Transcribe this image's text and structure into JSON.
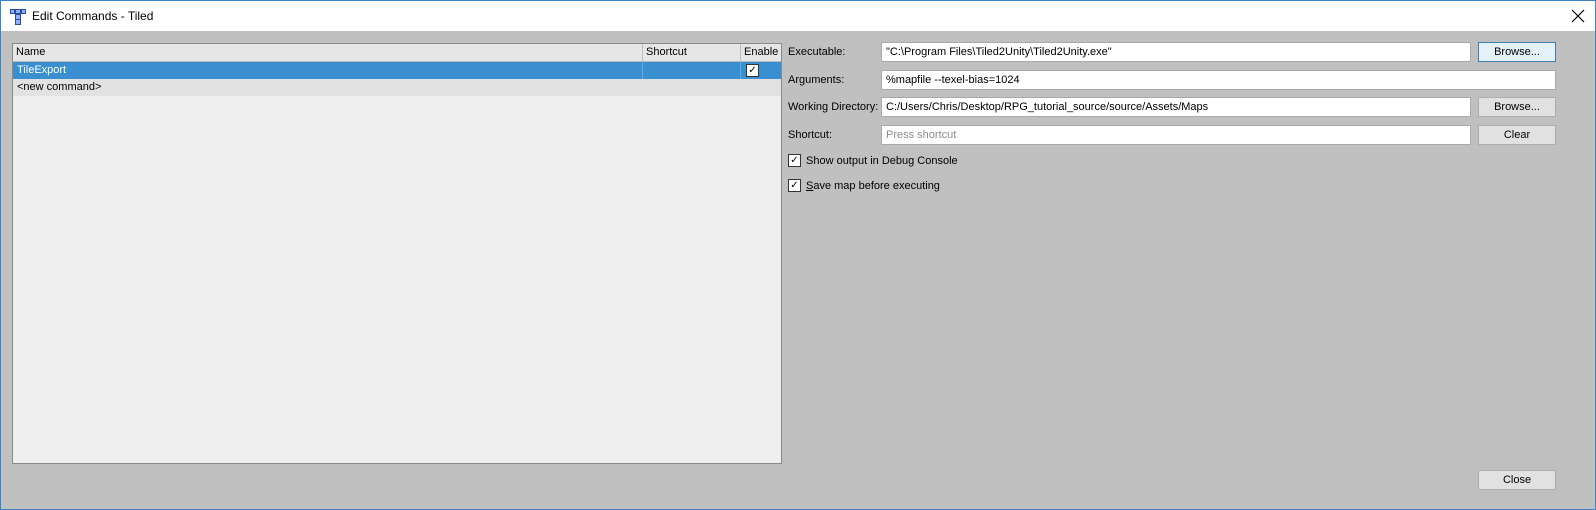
{
  "window": {
    "title": "Edit Commands - Tiled"
  },
  "table": {
    "columns": [
      "Name",
      "Shortcut",
      "Enable"
    ],
    "rows": [
      {
        "name": "TileExport",
        "shortcut": "",
        "enabled": true,
        "selected": true
      },
      {
        "name": "<new command>",
        "shortcut": "",
        "enabled": false,
        "selected": false
      }
    ]
  },
  "form": {
    "executable_label": "Executable:",
    "executable_value": "\"C:\\Program Files\\Tiled2Unity\\Tiled2Unity.exe\"",
    "browse_label": "Browse...",
    "arguments_label": "Arguments:",
    "arguments_value": "%mapfile --texel-bias=1024",
    "working_dir_label": "Working Directory:",
    "working_dir_value": "C:/Users/Chris/Desktop/RPG_tutorial_source/source/Assets/Maps",
    "browse2_label": "Browse...",
    "shortcut_label": "Shortcut:",
    "shortcut_placeholder": "Press shortcut",
    "clear_label": "Clear",
    "show_output": {
      "label": "Show output in Debug Console",
      "checked": true
    },
    "save_map": {
      "label_first": "S",
      "label_rest": "ave map before executing",
      "checked": true
    }
  },
  "footer": {
    "close_label": "Close"
  },
  "icons": {
    "app": "tiled-app-icon",
    "close": "close-icon",
    "check": "✓"
  },
  "colors": {
    "selection": "#3a8fd0",
    "window_bg": "#c0c0c0",
    "accent_border": "#3c83c8"
  }
}
